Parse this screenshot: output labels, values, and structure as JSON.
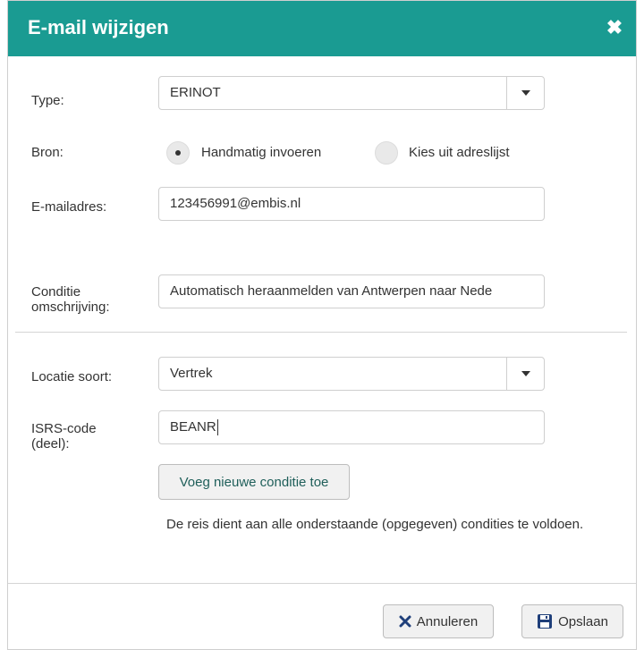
{
  "dialog": {
    "title": "E-mail wijzigen",
    "close_icon": "close-icon"
  },
  "form": {
    "type_label": "Type:",
    "type_value": "ERINOT",
    "bron_label": "Bron:",
    "bron_options": [
      "Handmatig invoeren",
      "Kies uit adreslijst"
    ],
    "bron_selected": "Handmatig invoeren",
    "email_label": "E-mailadres:",
    "email_value": "123456991@embis.nl",
    "conditie_label_line1": "Conditie",
    "conditie_label_line2": "omschrijving:",
    "conditie_value": "Automatisch heraanmelden van Antwerpen naar Nede",
    "locatie_label": "Locatie soort:",
    "locatie_value": "Vertrek",
    "isrs_label_line1": "ISRS-code",
    "isrs_label_line2": "(deel):",
    "isrs_value": "BEANR",
    "add_condition_label": "Voeg nieuwe conditie toe",
    "hint": "De reis dient aan alle onderstaande (opgegeven) condities te voldoen."
  },
  "footer": {
    "cancel_label": "Annuleren",
    "save_label": "Opslaan"
  },
  "colors": {
    "header": "#1a9b92"
  }
}
